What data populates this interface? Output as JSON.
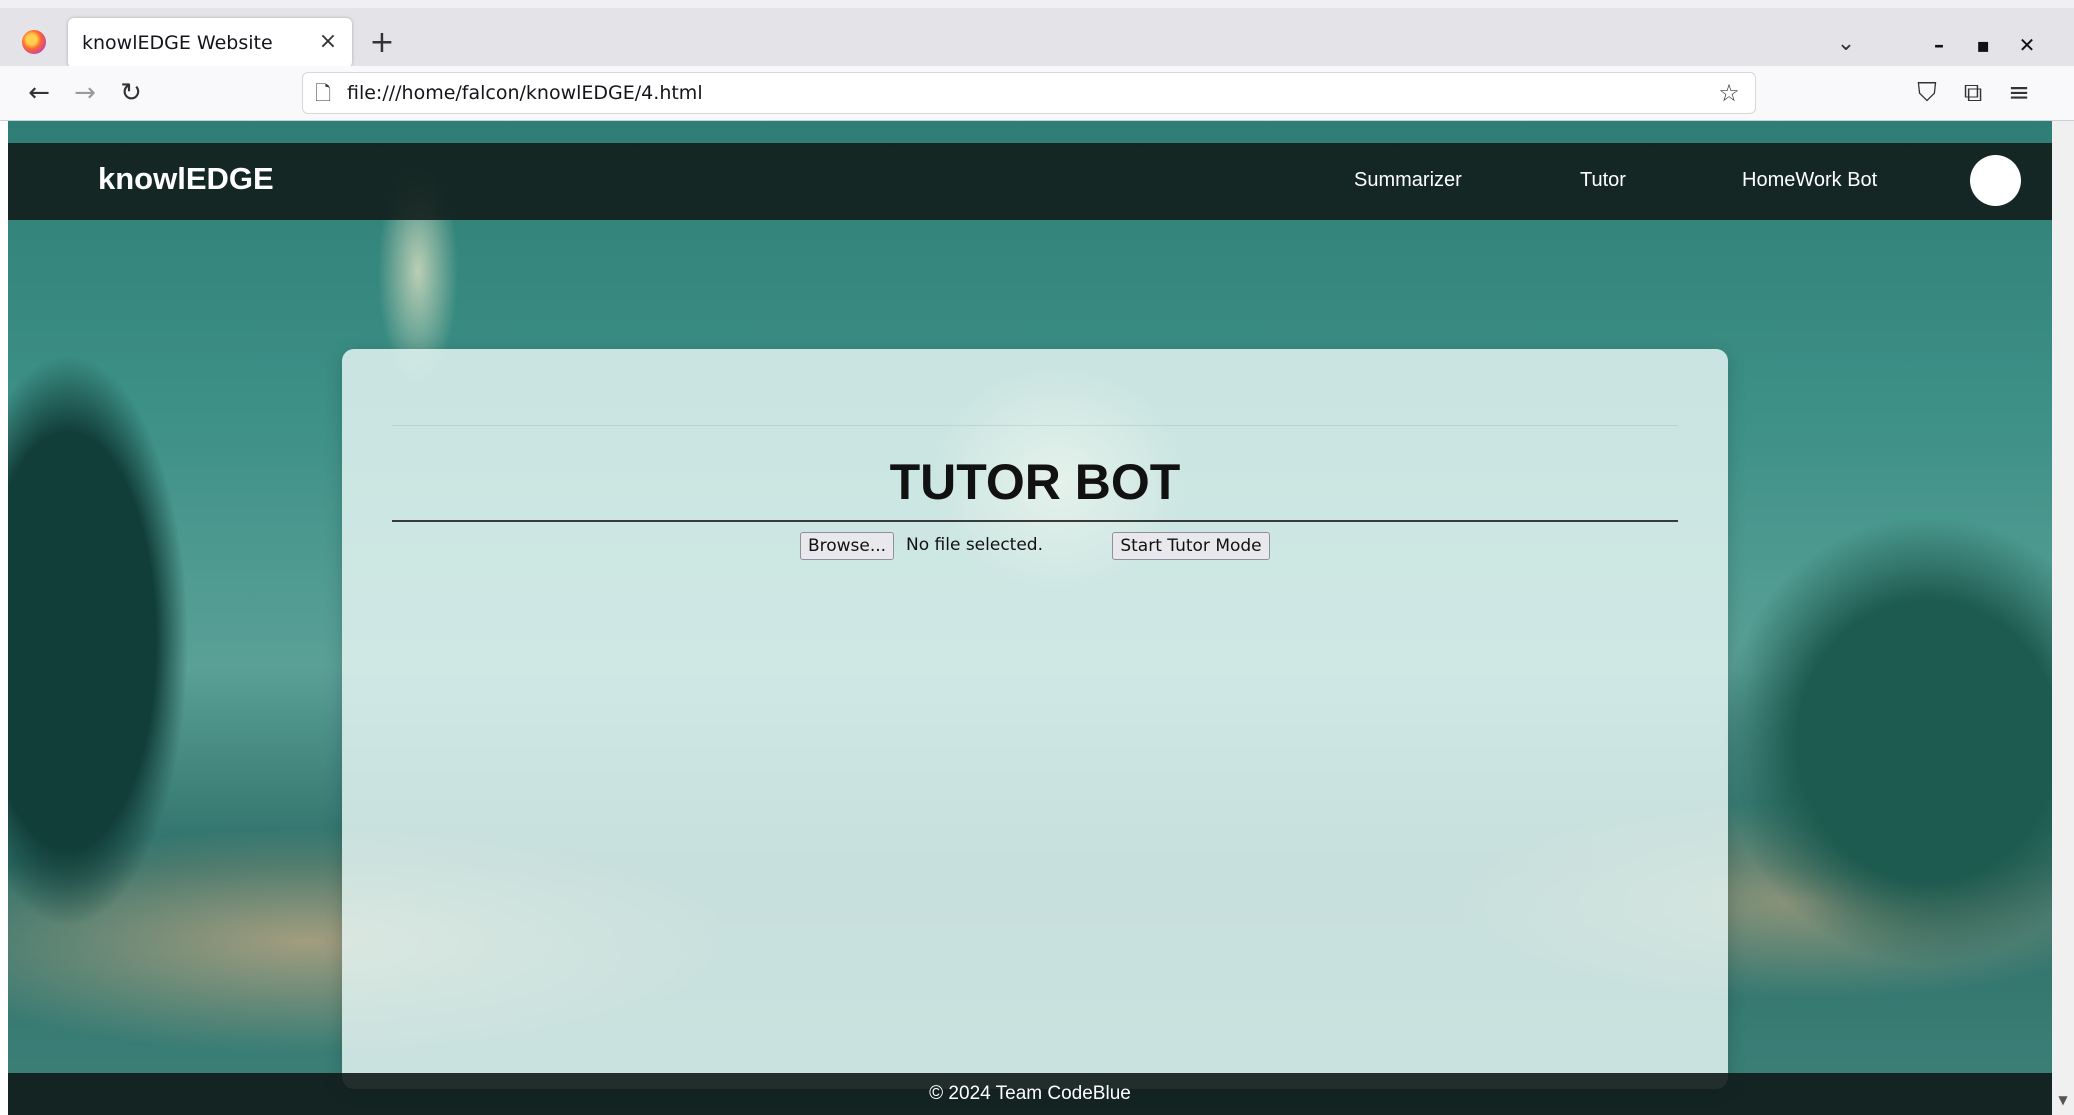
{
  "browser": {
    "tab_title": "knowlEDGE Website",
    "tab_close": "×",
    "new_tab": "+",
    "tab_list": "⌄",
    "url": "file:///home/falcon/knowlEDGE/4.html",
    "window": {
      "minimize": "–",
      "maximize": "▪",
      "close": "✕"
    },
    "nav": {
      "back": "←",
      "forward": "→",
      "reload": "↻",
      "page_icon": "🗋",
      "star": "☆",
      "pocket": "⛉",
      "extensions": "⧉",
      "menu": "≡"
    }
  },
  "site": {
    "brand": "knowlEDGE",
    "nav": [
      "Summarizer",
      "Tutor",
      "HomeWork Bot"
    ]
  },
  "tutor": {
    "title": "TUTOR BOT",
    "browse_label": "Browse...",
    "file_status": "No file selected.",
    "start_label": "Start Tutor Mode"
  },
  "footer": {
    "text": "© 2024 Team CodeBlue"
  },
  "colors": {
    "header_bg": "#101a18",
    "accent_teal": "#3d9187"
  }
}
